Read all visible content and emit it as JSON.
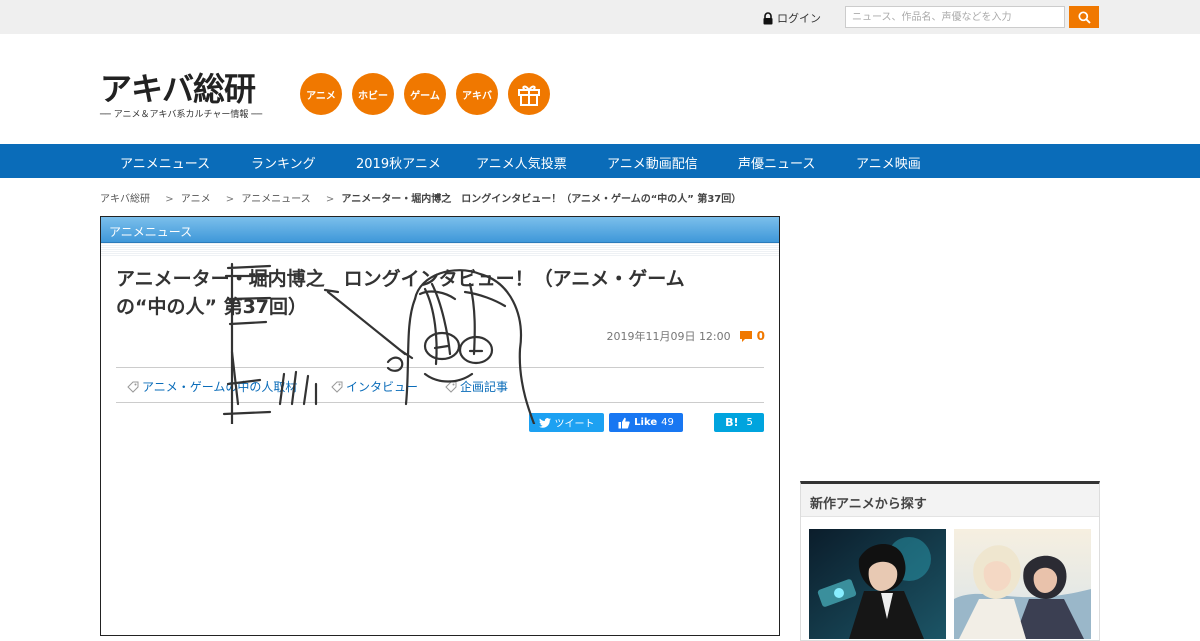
{
  "topbar": {
    "login_label": "ログイン",
    "search_placeholder": "ニュース、作品名、声優などを入力"
  },
  "logo": {
    "main": "アキバ総研",
    "sub": "── アニメ＆アキバ系カルチャー情報 ──"
  },
  "categories": [
    "アニメ",
    "ホビー",
    "ゲーム",
    "アキバ"
  ],
  "nav": [
    "アニメニュース",
    "ランキング",
    "2019秋アニメ",
    "アニメ人気投票",
    "アニメ動画配信",
    "声優ニュース",
    "アニメ映画"
  ],
  "breadcrumb": [
    "アキバ総研",
    "アニメ",
    "アニメニュース",
    "アニメーター・堀内博之　ロングインタビュー！（アニメ・ゲームの“中の人” 第37回）"
  ],
  "article": {
    "section": "アニメニュース",
    "title_line1": "アニメーター・堀内博之　ロングインタビュー！（アニメ・ゲーム",
    "title_line2": "の“中の人” 第37回）",
    "date": "2019年11月09日 12:00",
    "comments": "0",
    "tags": [
      "アニメ・ゲームの中の人取材",
      "インタビュー",
      "企画記事"
    ],
    "share": {
      "tweet_label": "ツイート",
      "like_label": "Like",
      "like_count": "49",
      "hatena_label": "B!",
      "hatena_count": "5"
    }
  },
  "sidebar": {
    "title": "新作アニメから探す"
  },
  "colors": {
    "accent_orange": "#f07800",
    "nav_blue": "#0a6cb9",
    "twitter": "#1da1f2",
    "facebook": "#1877f2",
    "hatena": "#00a4de"
  }
}
